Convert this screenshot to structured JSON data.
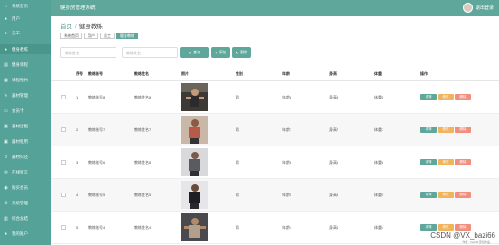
{
  "app": {
    "title": "健身房管理系统",
    "user_name": "退出登录"
  },
  "sidebar": {
    "items": [
      {
        "label": "系统首页",
        "icon": "home-icon"
      },
      {
        "label": "用户",
        "icon": "user-icon"
      },
      {
        "label": "员工",
        "icon": "user-icon"
      },
      {
        "label": "健身教练",
        "icon": "user-icon"
      },
      {
        "label": "健身课程",
        "icon": "book-icon"
      },
      {
        "label": "课程预约",
        "icon": "calendar-icon"
      },
      {
        "label": "器材管理",
        "icon": "wrench-icon"
      },
      {
        "label": "会员卡",
        "icon": "card-icon"
      },
      {
        "label": "器材出租",
        "icon": "box-icon"
      },
      {
        "label": "器材租用",
        "icon": "box-icon"
      },
      {
        "label": "器材归还",
        "icon": "return-icon"
      },
      {
        "label": "在线留言",
        "icon": "message-icon"
      },
      {
        "label": "购买会员",
        "icon": "cart-icon"
      },
      {
        "label": "系统管理",
        "icon": "gear-icon"
      },
      {
        "label": "综合总结",
        "icon": "chart-icon"
      },
      {
        "label": "我的账户",
        "icon": "account-icon"
      }
    ],
    "active_index": 3
  },
  "breadcrumb": {
    "home": "首页",
    "current": "健身教练"
  },
  "tags": [
    "系统首页",
    "用户",
    "员工",
    "健身教练"
  ],
  "search": {
    "placeholder1": "教练姓名",
    "placeholder2": "教练姓名",
    "search_label": "查询",
    "add_label": "添加",
    "delete_label": "删除"
  },
  "table": {
    "headers": [
      "序号",
      "教练账号",
      "教练姓名",
      "照片",
      "性别",
      "年龄",
      "身高",
      "体重",
      "操作"
    ],
    "rows": [
      {
        "index": "1",
        "account": "教练账号8",
        "name": "教练姓名8",
        "gender": "男",
        "age": "年龄8",
        "height": "身高8",
        "weight": "体重8"
      },
      {
        "index": "2",
        "account": "教练账号7",
        "name": "教练姓名7",
        "gender": "男",
        "age": "年龄7",
        "height": "身高7",
        "weight": "体重7"
      },
      {
        "index": "3",
        "account": "教练账号6",
        "name": "教练姓名6",
        "gender": "男",
        "age": "年龄6",
        "height": "身高6",
        "weight": "体重6"
      },
      {
        "index": "4",
        "account": "教练账号5",
        "name": "教练姓名5",
        "gender": "男",
        "age": "年龄5",
        "height": "身高5",
        "weight": "体重5"
      },
      {
        "index": "5",
        "account": "教练账号4",
        "name": "教练姓名4",
        "gender": "男",
        "age": "年龄4",
        "height": "身高4",
        "weight": "体重4"
      }
    ],
    "ops": {
      "view": "详情",
      "edit": "修改",
      "del": "删除"
    }
  },
  "watermark": {
    "main": "CSDN @VX_bazi66",
    "sub": "作者：bazi66 原创作品"
  },
  "colors": {
    "sidebar": "#55a398",
    "accent": "#5fa79b",
    "edit": "#f0b35e",
    "delete": "#f08f7e"
  }
}
